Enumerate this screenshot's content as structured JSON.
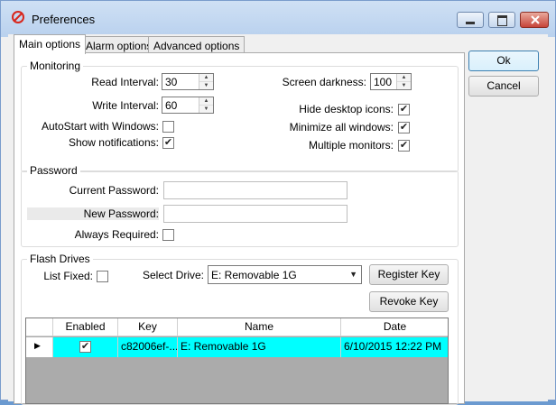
{
  "window": {
    "title": "Preferences",
    "icon": "no-entry-icon"
  },
  "tabs": [
    {
      "label": "Main options",
      "active": true
    },
    {
      "label": "Alarm options",
      "active": false
    },
    {
      "label": "Advanced options",
      "active": false
    }
  ],
  "monitoring": {
    "title": "Monitoring",
    "read_interval_label": "Read Interval:",
    "read_interval_value": "30",
    "write_interval_label": "Write Interval:",
    "write_interval_value": "60",
    "autostart_label": "AutoStart with Windows:",
    "autostart_checked": false,
    "show_notifications_label": "Show notifications:",
    "show_notifications_checked": true,
    "screen_darkness_label": "Screen darkness:",
    "screen_darkness_value": "100",
    "hide_desktop_icons_label": "Hide desktop icons:",
    "hide_desktop_icons_checked": true,
    "minimize_all_label": "Minimize all windows:",
    "minimize_all_checked": true,
    "multiple_monitors_label": "Multiple monitors:",
    "multiple_monitors_checked": true
  },
  "password": {
    "title": "Password",
    "current_label": "Current Password:",
    "current_value": "",
    "new_label": "New Password:",
    "new_value": "",
    "always_required_label": "Always Required:",
    "always_required_checked": false
  },
  "flash": {
    "title": "Flash Drives",
    "list_fixed_label": "List Fixed:",
    "list_fixed_checked": false,
    "select_drive_label": "Select Drive:",
    "select_drive_value": "E: Removable 1G",
    "register_label": "Register Key",
    "revoke_label": "Revoke Key",
    "columns": [
      "Enabled",
      "Key",
      "Name",
      "Date"
    ],
    "rows": [
      {
        "enabled": true,
        "key": "c82006ef-...",
        "name": "E: Removable 1G",
        "date": "6/10/2015 12:22 PM",
        "selected_color": "#00ffff"
      }
    ]
  },
  "buttons": {
    "ok": "Ok",
    "cancel": "Cancel"
  },
  "colors": {
    "selected_row": "#00ffff",
    "title_bar": "#cfe0f4"
  }
}
